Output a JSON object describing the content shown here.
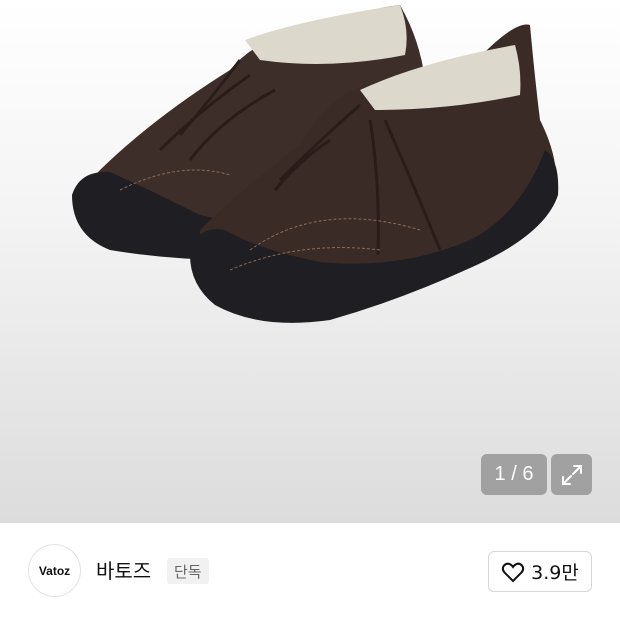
{
  "gallery": {
    "image_alt": "brown suede sneakers with black sole",
    "counter": "1 / 6",
    "expand_icon": "expand-arrows-icon"
  },
  "brand": {
    "logo_text": "Vatoz",
    "name": "바토즈",
    "badge": "단독"
  },
  "like": {
    "icon": "heart-outline-icon",
    "count": "3.9만"
  }
}
